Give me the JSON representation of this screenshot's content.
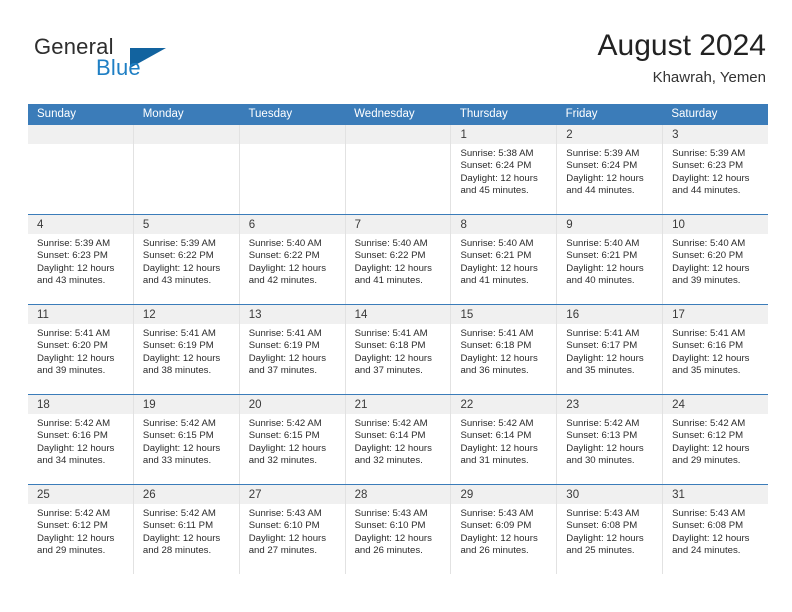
{
  "brand": {
    "word_general": "General",
    "word_blue": "Blue",
    "triangle_color": "#12639f",
    "blue_color": "#1f7fc4"
  },
  "header": {
    "month_title": "August 2024",
    "location": "Khawrah, Yemen"
  },
  "calendar": {
    "header_bg": "#3b7cb9",
    "daynum_bg": "#f0f0f0",
    "weekdays": [
      "Sunday",
      "Monday",
      "Tuesday",
      "Wednesday",
      "Thursday",
      "Friday",
      "Saturday"
    ],
    "weeks": [
      [
        {
          "day": "",
          "sunrise": "",
          "sunset": "",
          "daylight_line1": "",
          "daylight_line2": ""
        },
        {
          "day": "",
          "sunrise": "",
          "sunset": "",
          "daylight_line1": "",
          "daylight_line2": ""
        },
        {
          "day": "",
          "sunrise": "",
          "sunset": "",
          "daylight_line1": "",
          "daylight_line2": ""
        },
        {
          "day": "",
          "sunrise": "",
          "sunset": "",
          "daylight_line1": "",
          "daylight_line2": ""
        },
        {
          "day": "1",
          "sunrise": "Sunrise: 5:38 AM",
          "sunset": "Sunset: 6:24 PM",
          "daylight_line1": "Daylight: 12 hours",
          "daylight_line2": "and 45 minutes."
        },
        {
          "day": "2",
          "sunrise": "Sunrise: 5:39 AM",
          "sunset": "Sunset: 6:24 PM",
          "daylight_line1": "Daylight: 12 hours",
          "daylight_line2": "and 44 minutes."
        },
        {
          "day": "3",
          "sunrise": "Sunrise: 5:39 AM",
          "sunset": "Sunset: 6:23 PM",
          "daylight_line1": "Daylight: 12 hours",
          "daylight_line2": "and 44 minutes."
        }
      ],
      [
        {
          "day": "4",
          "sunrise": "Sunrise: 5:39 AM",
          "sunset": "Sunset: 6:23 PM",
          "daylight_line1": "Daylight: 12 hours",
          "daylight_line2": "and 43 minutes."
        },
        {
          "day": "5",
          "sunrise": "Sunrise: 5:39 AM",
          "sunset": "Sunset: 6:22 PM",
          "daylight_line1": "Daylight: 12 hours",
          "daylight_line2": "and 43 minutes."
        },
        {
          "day": "6",
          "sunrise": "Sunrise: 5:40 AM",
          "sunset": "Sunset: 6:22 PM",
          "daylight_line1": "Daylight: 12 hours",
          "daylight_line2": "and 42 minutes."
        },
        {
          "day": "7",
          "sunrise": "Sunrise: 5:40 AM",
          "sunset": "Sunset: 6:22 PM",
          "daylight_line1": "Daylight: 12 hours",
          "daylight_line2": "and 41 minutes."
        },
        {
          "day": "8",
          "sunrise": "Sunrise: 5:40 AM",
          "sunset": "Sunset: 6:21 PM",
          "daylight_line1": "Daylight: 12 hours",
          "daylight_line2": "and 41 minutes."
        },
        {
          "day": "9",
          "sunrise": "Sunrise: 5:40 AM",
          "sunset": "Sunset: 6:21 PM",
          "daylight_line1": "Daylight: 12 hours",
          "daylight_line2": "and 40 minutes."
        },
        {
          "day": "10",
          "sunrise": "Sunrise: 5:40 AM",
          "sunset": "Sunset: 6:20 PM",
          "daylight_line1": "Daylight: 12 hours",
          "daylight_line2": "and 39 minutes."
        }
      ],
      [
        {
          "day": "11",
          "sunrise": "Sunrise: 5:41 AM",
          "sunset": "Sunset: 6:20 PM",
          "daylight_line1": "Daylight: 12 hours",
          "daylight_line2": "and 39 minutes."
        },
        {
          "day": "12",
          "sunrise": "Sunrise: 5:41 AM",
          "sunset": "Sunset: 6:19 PM",
          "daylight_line1": "Daylight: 12 hours",
          "daylight_line2": "and 38 minutes."
        },
        {
          "day": "13",
          "sunrise": "Sunrise: 5:41 AM",
          "sunset": "Sunset: 6:19 PM",
          "daylight_line1": "Daylight: 12 hours",
          "daylight_line2": "and 37 minutes."
        },
        {
          "day": "14",
          "sunrise": "Sunrise: 5:41 AM",
          "sunset": "Sunset: 6:18 PM",
          "daylight_line1": "Daylight: 12 hours",
          "daylight_line2": "and 37 minutes."
        },
        {
          "day": "15",
          "sunrise": "Sunrise: 5:41 AM",
          "sunset": "Sunset: 6:18 PM",
          "daylight_line1": "Daylight: 12 hours",
          "daylight_line2": "and 36 minutes."
        },
        {
          "day": "16",
          "sunrise": "Sunrise: 5:41 AM",
          "sunset": "Sunset: 6:17 PM",
          "daylight_line1": "Daylight: 12 hours",
          "daylight_line2": "and 35 minutes."
        },
        {
          "day": "17",
          "sunrise": "Sunrise: 5:41 AM",
          "sunset": "Sunset: 6:16 PM",
          "daylight_line1": "Daylight: 12 hours",
          "daylight_line2": "and 35 minutes."
        }
      ],
      [
        {
          "day": "18",
          "sunrise": "Sunrise: 5:42 AM",
          "sunset": "Sunset: 6:16 PM",
          "daylight_line1": "Daylight: 12 hours",
          "daylight_line2": "and 34 minutes."
        },
        {
          "day": "19",
          "sunrise": "Sunrise: 5:42 AM",
          "sunset": "Sunset: 6:15 PM",
          "daylight_line1": "Daylight: 12 hours",
          "daylight_line2": "and 33 minutes."
        },
        {
          "day": "20",
          "sunrise": "Sunrise: 5:42 AM",
          "sunset": "Sunset: 6:15 PM",
          "daylight_line1": "Daylight: 12 hours",
          "daylight_line2": "and 32 minutes."
        },
        {
          "day": "21",
          "sunrise": "Sunrise: 5:42 AM",
          "sunset": "Sunset: 6:14 PM",
          "daylight_line1": "Daylight: 12 hours",
          "daylight_line2": "and 32 minutes."
        },
        {
          "day": "22",
          "sunrise": "Sunrise: 5:42 AM",
          "sunset": "Sunset: 6:14 PM",
          "daylight_line1": "Daylight: 12 hours",
          "daylight_line2": "and 31 minutes."
        },
        {
          "day": "23",
          "sunrise": "Sunrise: 5:42 AM",
          "sunset": "Sunset: 6:13 PM",
          "daylight_line1": "Daylight: 12 hours",
          "daylight_line2": "and 30 minutes."
        },
        {
          "day": "24",
          "sunrise": "Sunrise: 5:42 AM",
          "sunset": "Sunset: 6:12 PM",
          "daylight_line1": "Daylight: 12 hours",
          "daylight_line2": "and 29 minutes."
        }
      ],
      [
        {
          "day": "25",
          "sunrise": "Sunrise: 5:42 AM",
          "sunset": "Sunset: 6:12 PM",
          "daylight_line1": "Daylight: 12 hours",
          "daylight_line2": "and 29 minutes."
        },
        {
          "day": "26",
          "sunrise": "Sunrise: 5:42 AM",
          "sunset": "Sunset: 6:11 PM",
          "daylight_line1": "Daylight: 12 hours",
          "daylight_line2": "and 28 minutes."
        },
        {
          "day": "27",
          "sunrise": "Sunrise: 5:43 AM",
          "sunset": "Sunset: 6:10 PM",
          "daylight_line1": "Daylight: 12 hours",
          "daylight_line2": "and 27 minutes."
        },
        {
          "day": "28",
          "sunrise": "Sunrise: 5:43 AM",
          "sunset": "Sunset: 6:10 PM",
          "daylight_line1": "Daylight: 12 hours",
          "daylight_line2": "and 26 minutes."
        },
        {
          "day": "29",
          "sunrise": "Sunrise: 5:43 AM",
          "sunset": "Sunset: 6:09 PM",
          "daylight_line1": "Daylight: 12 hours",
          "daylight_line2": "and 26 minutes."
        },
        {
          "day": "30",
          "sunrise": "Sunrise: 5:43 AM",
          "sunset": "Sunset: 6:08 PM",
          "daylight_line1": "Daylight: 12 hours",
          "daylight_line2": "and 25 minutes."
        },
        {
          "day": "31",
          "sunrise": "Sunrise: 5:43 AM",
          "sunset": "Sunset: 6:08 PM",
          "daylight_line1": "Daylight: 12 hours",
          "daylight_line2": "and 24 minutes."
        }
      ]
    ]
  }
}
